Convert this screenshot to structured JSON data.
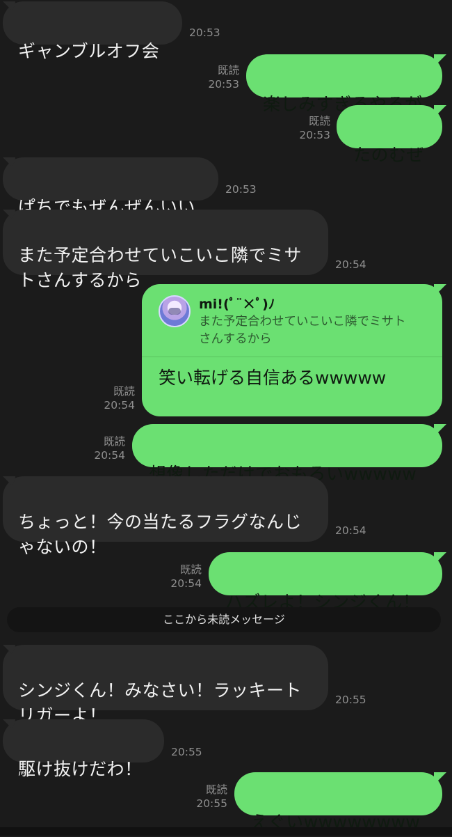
{
  "read_label": "既読",
  "messages": [
    {
      "dir": "in",
      "text": "ギャンブルオフ会",
      "time": "20:53"
    },
    {
      "dir": "out",
      "text": "楽しみすぎるやろが",
      "time": "20:53",
      "read": true
    },
    {
      "dir": "out",
      "text": "たのむぜ",
      "time": "20:53",
      "read": true
    },
    {
      "dir": "in",
      "text": "ぱちでもぜんぜんいい",
      "time": "20:53"
    },
    {
      "dir": "in",
      "text": "また予定合わせていこいこ隣でミサ\nトさんするから",
      "time": "20:54"
    },
    {
      "dir": "out",
      "type": "reply",
      "reply_name": "mi!(ﾟ¨×ﾟ)ﾉ",
      "reply_quote": "また予定合わせていこいこ隣でミサト\nさんするから",
      "text": "笑い転げる自信あるwwwww",
      "time": "20:54",
      "read": true
    },
    {
      "dir": "out",
      "text": "想像しただけでおもろいwwwww",
      "time": "20:54",
      "read": true
    },
    {
      "dir": "in",
      "text": "ちょっと！今の当たるフラグなんじ\nゃないの！",
      "time": "20:54"
    },
    {
      "dir": "out",
      "text": "ハズレよ！シンジくん！",
      "time": "20:54",
      "read": true
    },
    {
      "dir": "in",
      "text": "シンジくん！みなさい！ラッキート\nリガーよ！",
      "time": "20:55"
    },
    {
      "dir": "in",
      "text": "駆け抜けだわ！",
      "time": "20:55"
    },
    {
      "dir": "out",
      "text": "えぐいwwwwwwww",
      "time": "20:55",
      "read": true
    }
  ],
  "unread_divider": "ここから未読メッセージ"
}
